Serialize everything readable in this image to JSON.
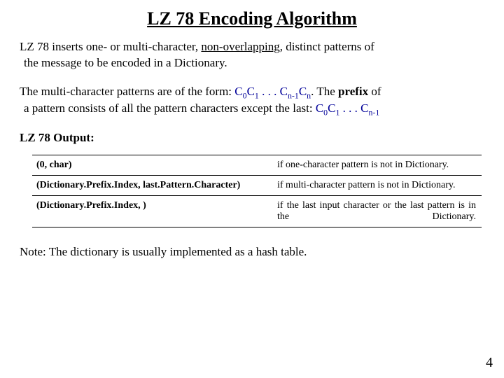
{
  "title": "LZ 78 Encoding Algorithm",
  "p1": {
    "lead": "LZ 78 inserts one- or multi-character, ",
    "nonov": "non-overlapping",
    "after_nonov": ", distinct patterns of",
    "cont": "the message to be encoded in a Dictionary."
  },
  "p2": {
    "lead": "The multi-character patterns are of the form: ",
    "seq_end": ". The ",
    "prefix_word": "prefix",
    "after_prefix": " of",
    "cont_a": "a pattern consists of all the pattern characters except the last:  "
  },
  "seq": {
    "c": "C",
    "i0": "0",
    "i1": "1",
    "dots": " .  .  . ",
    "nm1": "n-1",
    "n": "n"
  },
  "output_head": "LZ 78 Output:",
  "table": {
    "r1": {
      "l": "(0, char)",
      "r": "if one-character pattern is not in Dictionary."
    },
    "r2": {
      "l": "(Dictionary.Prefix.Index, last.Pattern.Character)",
      "r": "if multi-character pattern is not in Dictionary."
    },
    "r3": {
      "l": "(Dictionary.Prefix.Index,    )",
      "r": "if the last input character or the last pattern is in the Dictionary."
    }
  },
  "note": "Note: The dictionary is usually implemented as a hash table.",
  "pagenum": "4"
}
